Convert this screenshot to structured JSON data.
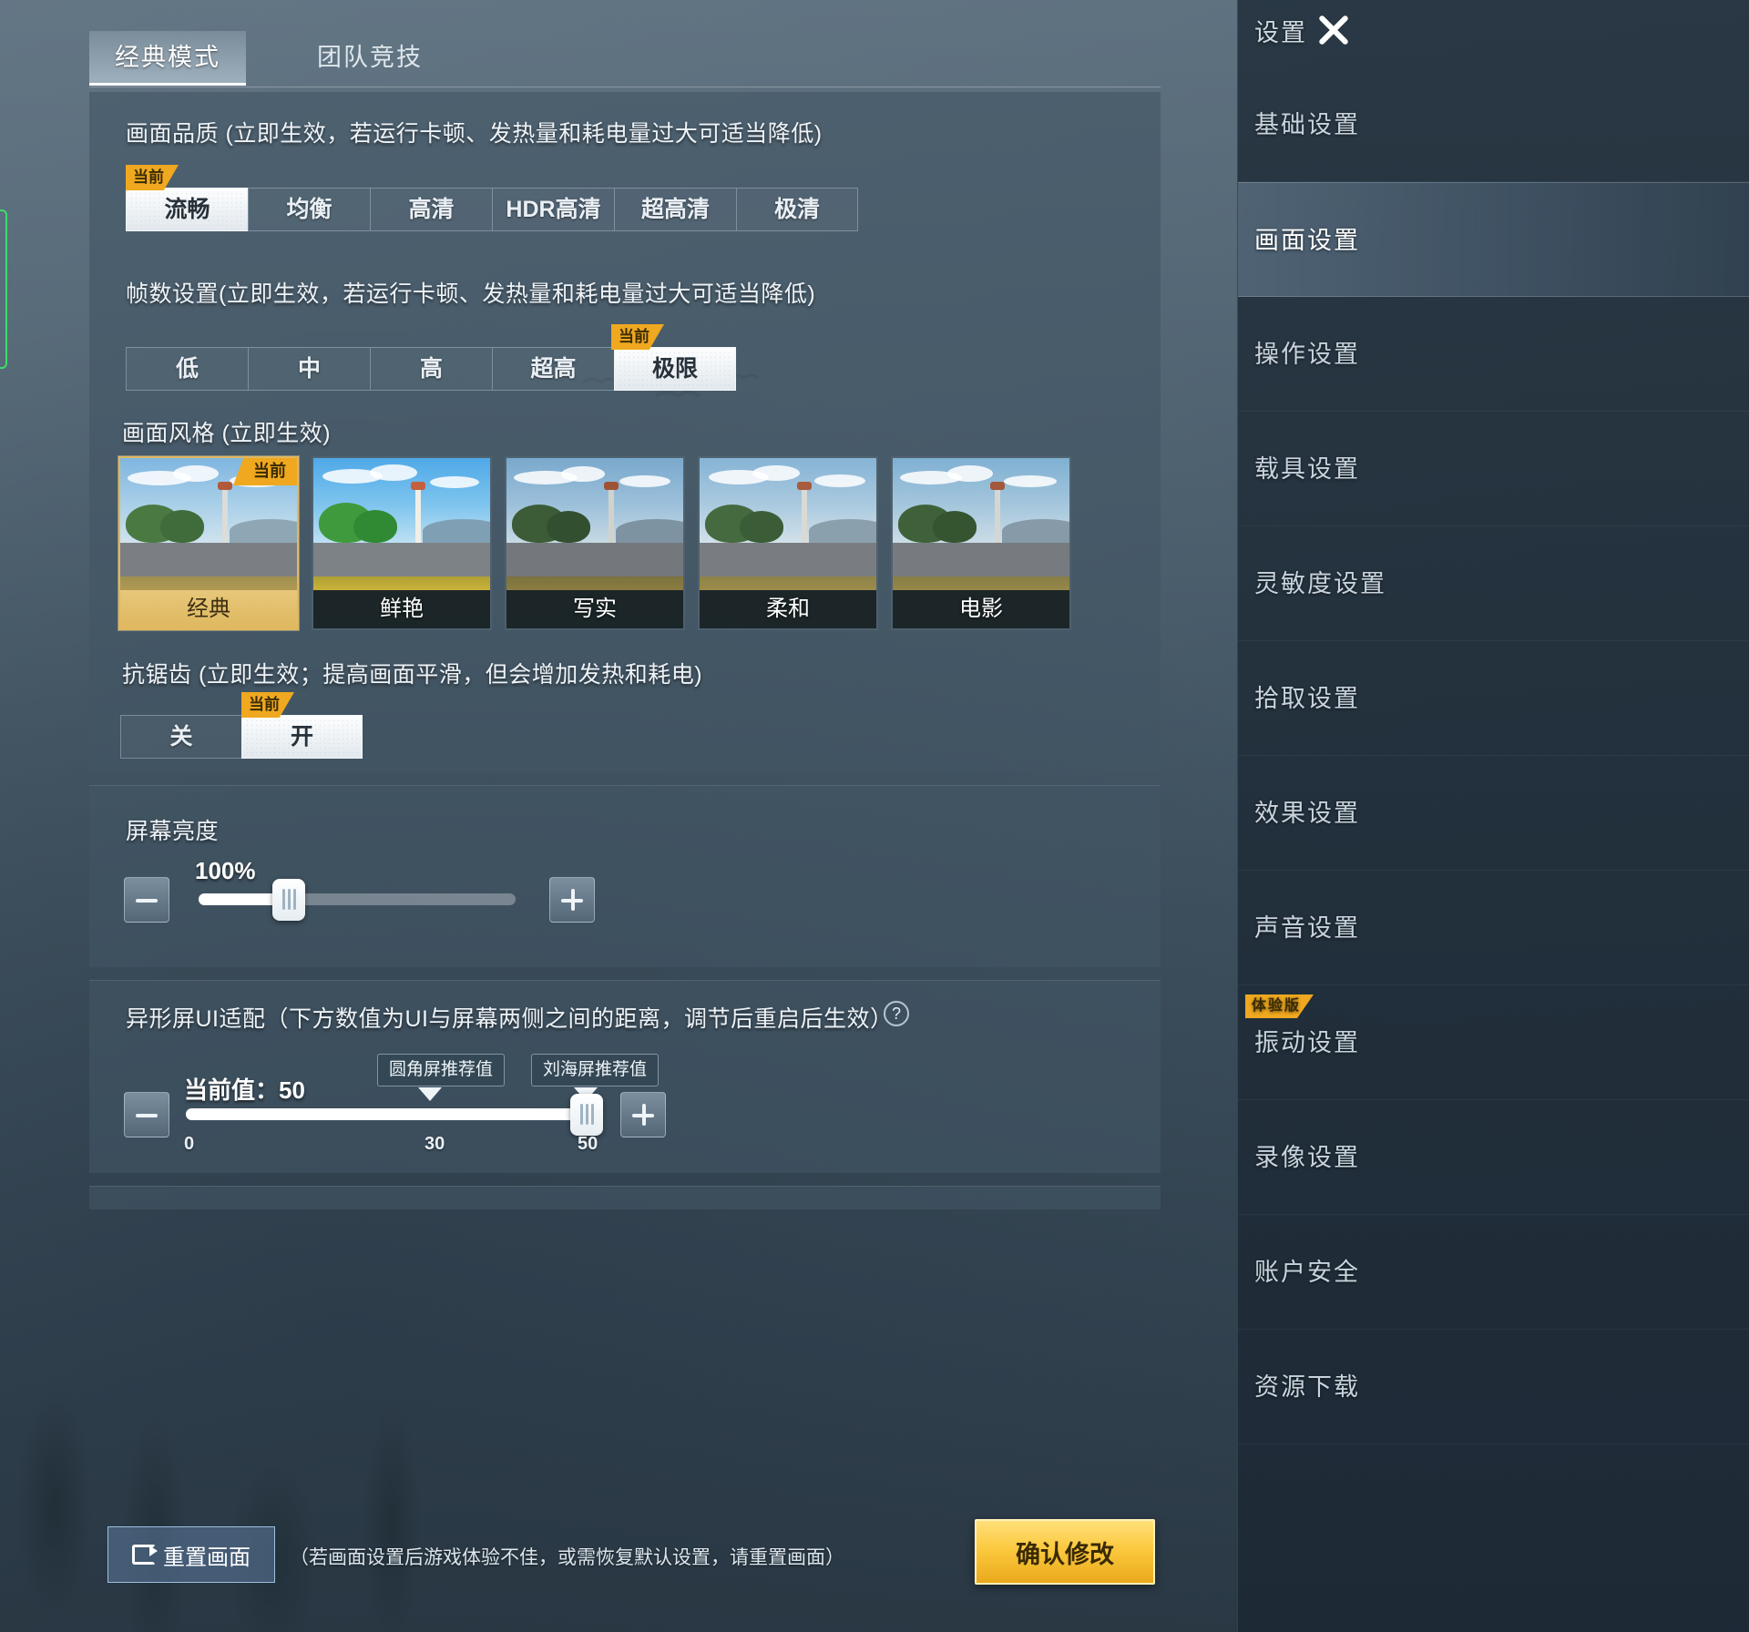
{
  "tabs": [
    {
      "label": "经典模式",
      "active": true
    },
    {
      "label": "团队竞技",
      "active": false
    }
  ],
  "graphics": {
    "quality": {
      "title": "画面品质 (立即生效，若运行卡顿、发热量和耗电量过大可适当降低)",
      "current_tag": "当前",
      "options": [
        "流畅",
        "均衡",
        "高清",
        "HDR高清",
        "超高清",
        "极清"
      ],
      "selected": "流畅"
    },
    "framerate": {
      "title": "帧数设置(立即生效，若运行卡顿、发热量和耗电量过大可适当降低)",
      "current_tag": "当前",
      "options": [
        "低",
        "中",
        "高",
        "超高",
        "极限"
      ],
      "selected": "极限"
    },
    "style": {
      "title": "画面风格 (立即生效)",
      "current_tag": "当前",
      "options": [
        "经典",
        "鲜艳",
        "写实",
        "柔和",
        "电影"
      ],
      "selected": "经典"
    },
    "antialias": {
      "title": "抗锯齿 (立即生效；提高画面平滑，但会增加发热和耗电)",
      "current_tag": "当前",
      "options": [
        "关",
        "开"
      ],
      "selected": "开"
    }
  },
  "brightness": {
    "title": "屏幕亮度",
    "value_label": "100%",
    "percent": 28,
    "minus_label": "−",
    "plus_label": "+"
  },
  "notch": {
    "title": "异形屏UI适配（下方数值为UI与屏幕两侧之间的距离，调节后重启后生效）",
    "help_label": "?",
    "current_value_label": "当前值：50",
    "value": 50,
    "min": 0,
    "max": 50,
    "ticks": [
      "0",
      "30",
      "50"
    ],
    "tooltips": [
      {
        "label": "圆角屏推荐值",
        "at": 30
      },
      {
        "label": "刘海屏推荐值",
        "at": 50
      }
    ]
  },
  "footer": {
    "reset_label": "重置画面",
    "note": "（若画面设置后游戏体验不佳，或需恢复默认设置，请重置画面）",
    "confirm_label": "确认修改"
  },
  "sidebar": {
    "title": "设置",
    "close_icon": "close-icon",
    "items": [
      {
        "label": "基础设置",
        "active": false
      },
      {
        "label": "画面设置",
        "active": true
      },
      {
        "label": "操作设置",
        "active": false
      },
      {
        "label": "载具设置",
        "active": false
      },
      {
        "label": "灵敏度设置",
        "active": false
      },
      {
        "label": "拾取设置",
        "active": false
      },
      {
        "label": "效果设置",
        "active": false
      },
      {
        "label": "声音设置",
        "active": false
      },
      {
        "label": "振动设置",
        "active": false,
        "badge": "体验版"
      },
      {
        "label": "录像设置",
        "active": false
      },
      {
        "label": "账户安全",
        "active": false
      },
      {
        "label": "资源下载",
        "active": false
      }
    ]
  },
  "colors": {
    "accent_yellow": "#efa81f",
    "confirm_gold": "#fbc93f",
    "panel_bg": "#425564",
    "selected_white": "#eef2f5",
    "sidebar_bg": "#223040"
  }
}
